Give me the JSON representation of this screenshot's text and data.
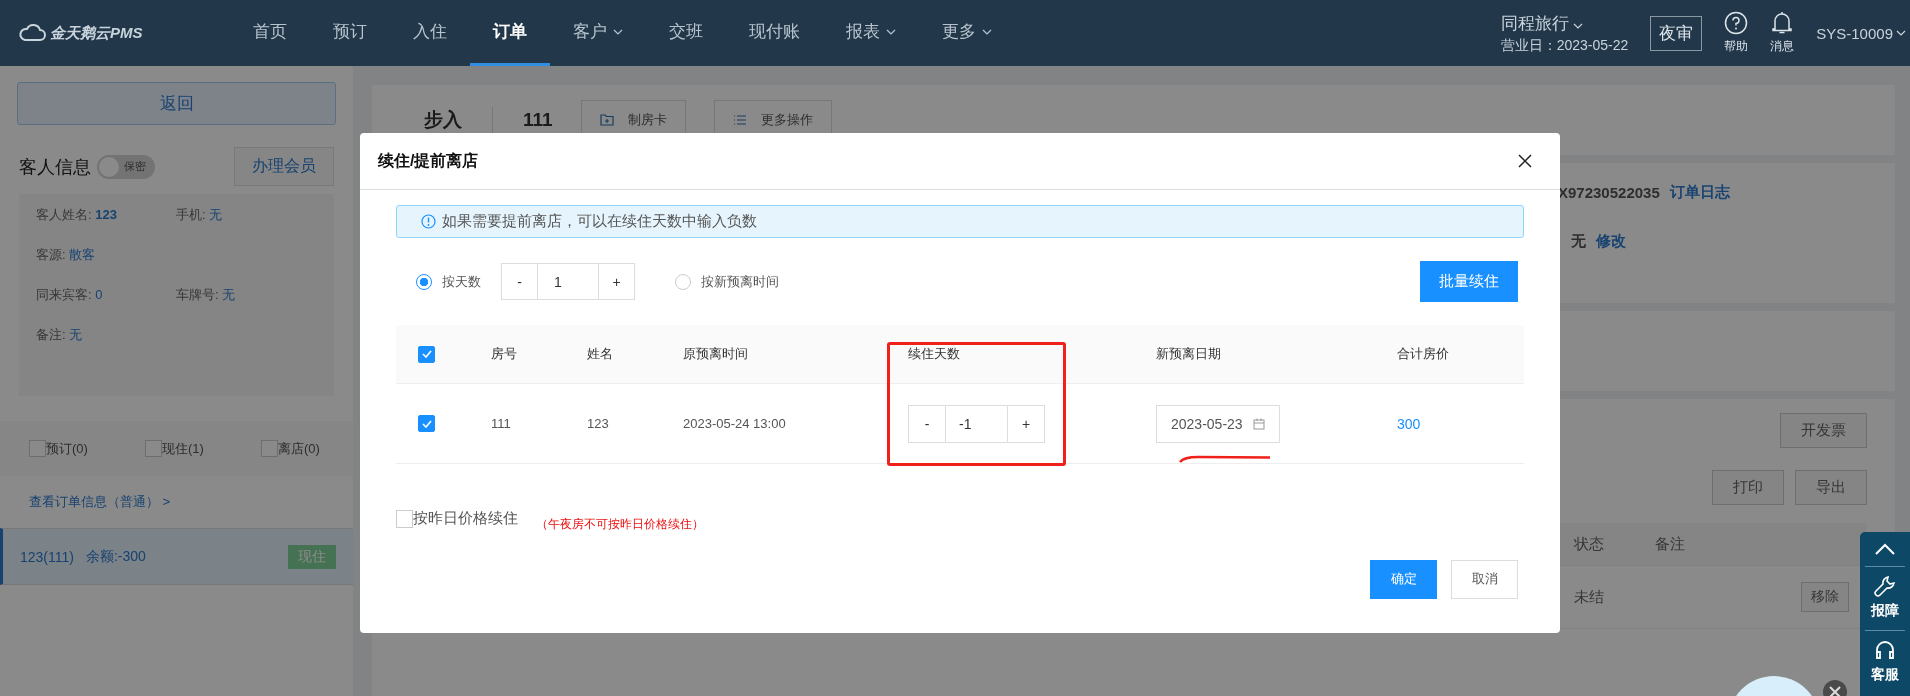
{
  "nav": {
    "logo": "金天鹅云PMS",
    "items": [
      {
        "label": "首页",
        "selected": false,
        "dropdown": false
      },
      {
        "label": "预订",
        "selected": false,
        "dropdown": false
      },
      {
        "label": "入住",
        "selected": false,
        "dropdown": false
      },
      {
        "label": "订单",
        "selected": true,
        "dropdown": false
      },
      {
        "label": "客户",
        "selected": false,
        "dropdown": true
      },
      {
        "label": "交班",
        "selected": false,
        "dropdown": false
      },
      {
        "label": "现付账",
        "selected": false,
        "dropdown": false
      },
      {
        "label": "报表",
        "selected": false,
        "dropdown": true
      },
      {
        "label": "更多",
        "selected": false,
        "dropdown": true
      }
    ],
    "hotel": "同程旅行",
    "business_date": "营业日：2023-05-22",
    "night_audit": "夜审",
    "help": "帮助",
    "messages": "消息",
    "user": "SYS-10009"
  },
  "sidebar": {
    "back": "返回",
    "guest_info": "客人信息",
    "privacy": {
      "label": "保密",
      "on": false
    },
    "member_button": "办理会员",
    "info_rows": [
      [
        {
          "label": "客人姓名:",
          "value": "123"
        },
        {
          "label": "手机:",
          "value": "无"
        }
      ],
      [
        {
          "label": "客源:",
          "value": "散客"
        }
      ],
      [
        {
          "label": "同来宾客:",
          "value": "0"
        },
        {
          "label": "车牌号:",
          "value": "无"
        }
      ],
      [
        {
          "label": "备注:",
          "value": "无"
        }
      ]
    ],
    "filters": [
      {
        "label": "预订(0)",
        "checked": false
      },
      {
        "label": "现住(1)",
        "checked": false
      },
      {
        "label": "离店(0)",
        "checked": false
      }
    ],
    "order_link": "查看订单信息（普通） >",
    "rooms": [
      {
        "label": "123(111)",
        "balance": "余额:-300",
        "status": "现住",
        "selected": true
      }
    ]
  },
  "background": {
    "source": "步入",
    "room": "111",
    "buttons": [
      "制房卡",
      "更多操作"
    ],
    "order_no": "X97230522035",
    "order_log": "订单日志",
    "remark": "无",
    "modify": "修改",
    "invoice": "开发票",
    "print": "打印",
    "export": "导出",
    "columns": [
      "状态",
      "备注"
    ],
    "rows": [
      {
        "status": "未结",
        "action": "移除"
      }
    ]
  },
  "dialog": {
    "title": "续住/提前离店",
    "notice": "如果需要提前离店，可以在续住天数中输入负数",
    "modes": [
      {
        "label": "按天数",
        "selected": true
      },
      {
        "label": "按新预离时间",
        "selected": false
      }
    ],
    "stepper": {
      "minus": "-",
      "value": "1",
      "plus": "+"
    },
    "batch_button": "批量续住",
    "select_all": {
      "checked": true
    },
    "columns": [
      "房号",
      "姓名",
      "原预离时间",
      "续住天数",
      "新预离日期",
      "合计房价"
    ],
    "rows": [
      {
        "checked": true,
        "room": "111",
        "name": "123",
        "original_departure": "2023-05-24 13:00",
        "days": {
          "minus": "-",
          "value": "-1",
          "plus": "+"
        },
        "new_departure": "2023-05-23",
        "total": "300"
      }
    ],
    "yesterday_price": {
      "label": "按昨日价格续住",
      "checked": false,
      "note": "（午夜房不可按昨日价格续住）"
    },
    "buttons": [
      {
        "label": "确定",
        "kind": "primary"
      },
      {
        "label": "取消",
        "kind": "default"
      }
    ]
  },
  "side_tools": [
    {
      "label": "报障",
      "kind": "wrench"
    },
    {
      "label": "客服",
      "kind": "headset"
    }
  ]
}
